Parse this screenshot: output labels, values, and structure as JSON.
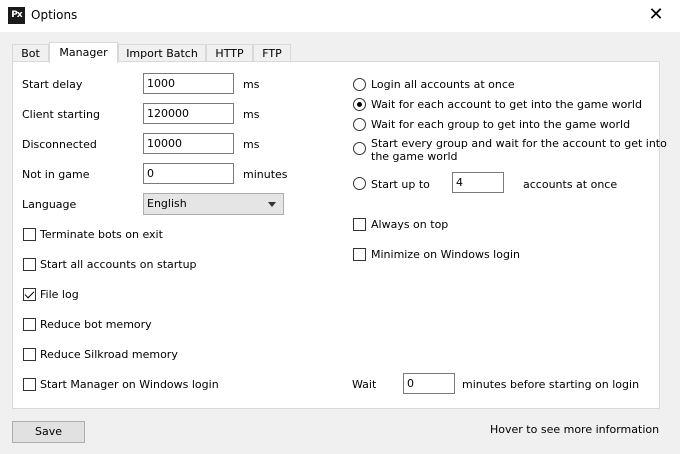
{
  "window": {
    "title": "Options",
    "icon_text": "Px",
    "close_glyph": "✕"
  },
  "tabs": [
    {
      "label": "Bot",
      "active": false
    },
    {
      "label": "Manager",
      "active": true
    },
    {
      "label": "Import Batch",
      "active": false
    },
    {
      "label": "HTTP",
      "active": false
    },
    {
      "label": "FTP",
      "active": false
    }
  ],
  "left": {
    "start_delay": {
      "label": "Start delay",
      "value": "1000",
      "unit": "ms"
    },
    "client_starting": {
      "label": "Client starting",
      "value": "120000",
      "unit": "ms"
    },
    "disconnected": {
      "label": "Disconnected",
      "value": "10000",
      "unit": "ms"
    },
    "not_in_game": {
      "label": "Not in game",
      "value": "0",
      "unit": "minutes"
    },
    "language": {
      "label": "Language",
      "value": "English"
    },
    "checkboxes": [
      {
        "label": "Terminate bots on exit",
        "checked": false
      },
      {
        "label": "Start all accounts on startup",
        "checked": false
      },
      {
        "label": "File log",
        "checked": true
      },
      {
        "label": "Reduce bot memory",
        "checked": false
      },
      {
        "label": "Reduce Silkroad memory",
        "checked": false
      },
      {
        "label": "Start Manager on Windows login",
        "checked": false
      }
    ]
  },
  "right": {
    "radios": [
      {
        "label": "Login all accounts at once",
        "selected": false
      },
      {
        "label": "Wait for each account to get into the game world",
        "selected": true
      },
      {
        "label": "Wait for each group to get into the game world",
        "selected": false
      },
      {
        "label": "Start every group and wait for the account to get into",
        "label2": "the game world",
        "selected": false
      },
      {
        "label": "Start up to",
        "selected": false,
        "value": "4",
        "suffix": "accounts at once"
      }
    ],
    "checkboxes": [
      {
        "label": "Always on top",
        "checked": false
      },
      {
        "label": "Minimize on Windows login",
        "checked": false
      }
    ],
    "wait": {
      "label": "Wait",
      "value": "0",
      "suffix": "minutes before starting on login"
    }
  },
  "footer": {
    "save_label": "Save",
    "hint": "Hover to see more information"
  }
}
